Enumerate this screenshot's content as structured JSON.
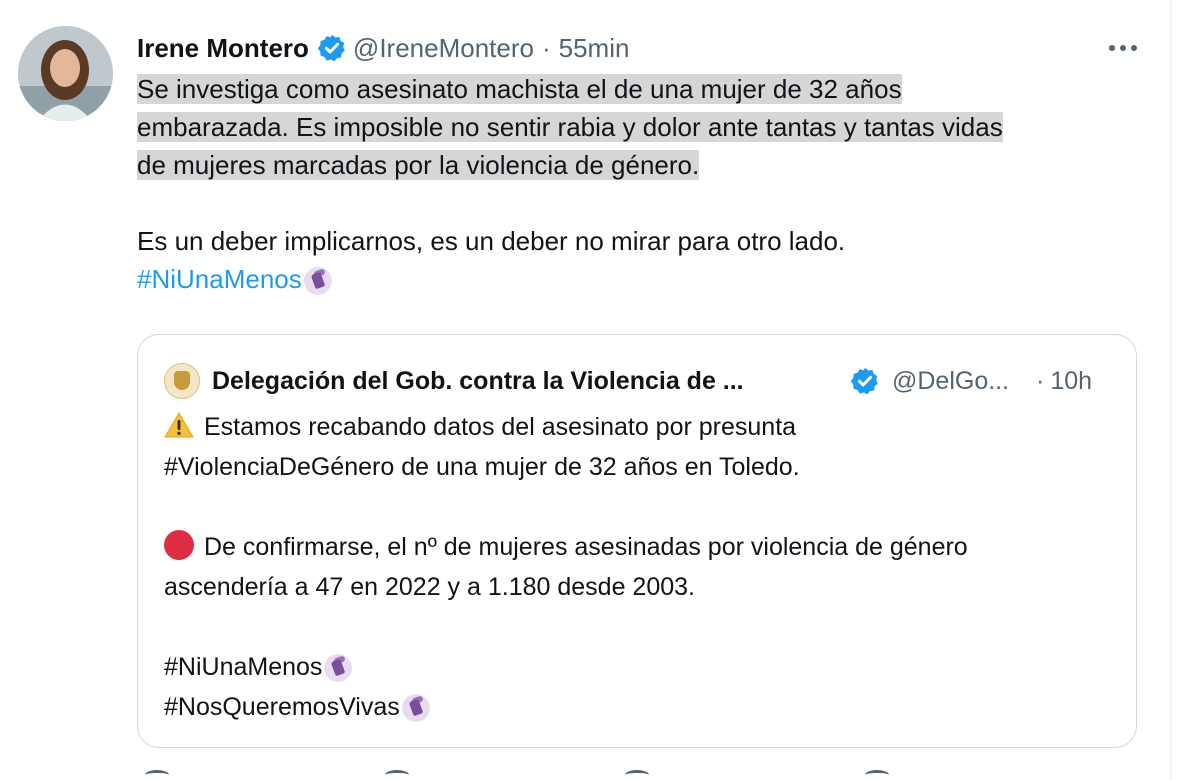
{
  "tweet": {
    "author_name": "Irene Montero",
    "handle": "@IreneMontero",
    "separator": "·",
    "time": "55min",
    "text_lines_highlighted": [
      "Se investiga como asesinato machista el de una mujer de 32 años",
      "embarazada. Es imposible no sentir rabia y dolor ante tantas y tantas vidas",
      "de mujeres marcadas por la violencia de género."
    ],
    "text_line_2": "Es un deber implicarnos, es un deber no mirar para otro lado.",
    "hashtag": "#NiUnaMenos"
  },
  "quoted_tweet": {
    "author_name": "Delegación del Gob. contra la Violencia de ...",
    "handle": "@DelGo...",
    "separator": "·",
    "time": "10h",
    "line_1": "Estamos recabando datos del asesinato por presunta",
    "line_2": "#ViolenciaDeGénero de una mujer de 32 años en Toledo.",
    "line_3": "De confirmarse, el nº de mujeres asesinadas por violencia de género",
    "line_4": "ascendería a 47 en 2022 y a 1.180 desde 2003.",
    "hashtag_1": "#NiUnaMenos",
    "hashtag_2": "#NosQueremosVivas"
  },
  "icons": {
    "more": "more-icon",
    "verified": "verified-badge-icon",
    "warning": "warning-icon",
    "red_circle": "red-circle-icon",
    "fist": "raised-fist-icon"
  },
  "colors": {
    "text": "#0f1419",
    "secondary": "#536471",
    "link": "#1d9bf0",
    "highlight": "#d6d6d6",
    "border": "#cfd9de"
  }
}
